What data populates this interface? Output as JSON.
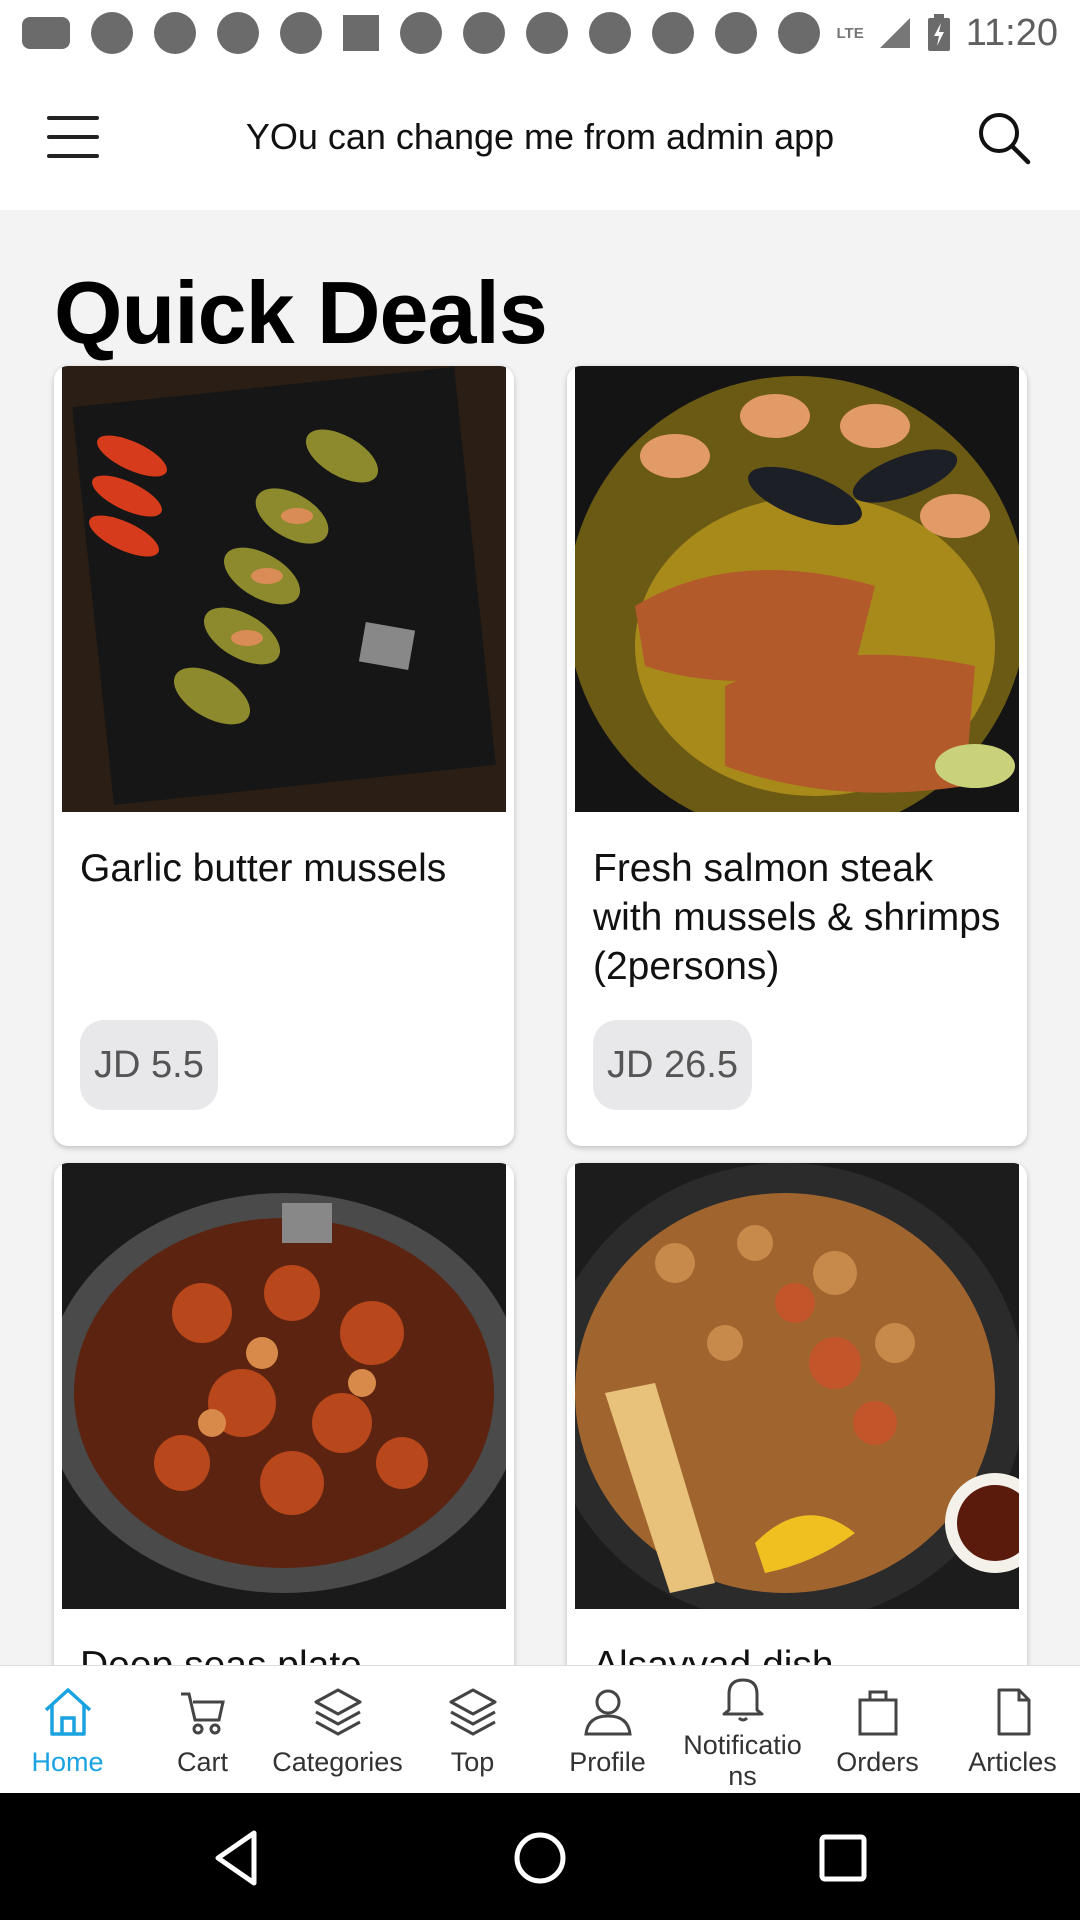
{
  "status_bar": {
    "time": "11:20",
    "network": "LTE"
  },
  "app_bar": {
    "title": "YOu can change me from admin app",
    "menu_icon": "hamburger-menu-icon",
    "search_icon": "search-icon"
  },
  "section": {
    "title": "Quick Deals"
  },
  "products": [
    {
      "name": "Garlic butter mussels",
      "price": "JD 5.5"
    },
    {
      "name": "Fresh salmon steak with mussels & shrimps (2persons)",
      "price": "JD 26.5"
    },
    {
      "name": "Deep seas plate"
    },
    {
      "name": "Alsayyad dish"
    }
  ],
  "bottom_nav": [
    {
      "label": "Home",
      "icon": "home-icon",
      "active": true
    },
    {
      "label": "Cart",
      "icon": "cart-icon"
    },
    {
      "label": "Categories",
      "icon": "layers-icon"
    },
    {
      "label": "Top",
      "icon": "layers-icon"
    },
    {
      "label": "Profile",
      "icon": "person-icon"
    },
    {
      "label": "Notificatio\nns",
      "icon": "bell-icon"
    },
    {
      "label": "Orders",
      "icon": "bag-icon"
    },
    {
      "label": "Articles",
      "icon": "document-icon"
    }
  ],
  "colors": {
    "accent": "#1aa3e0",
    "price_badge": "#e8e8ea",
    "background": "#f3f3f3"
  }
}
